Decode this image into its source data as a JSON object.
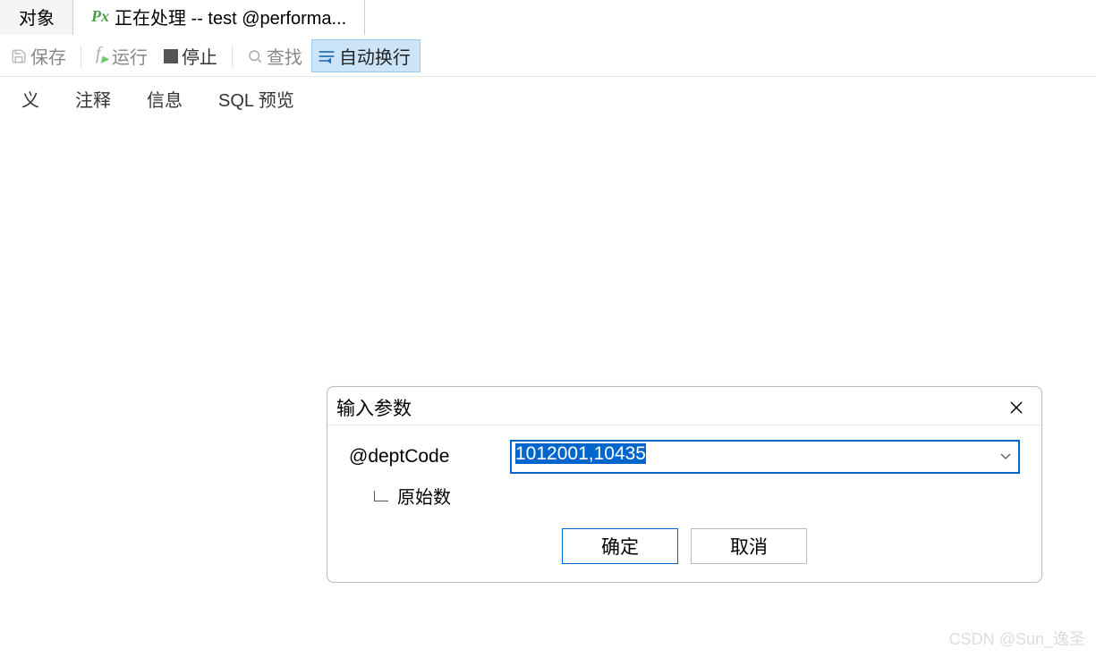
{
  "window_tabs": {
    "object": "对象",
    "processing": "正在处理 -- test @performa..."
  },
  "toolbar": {
    "save": "保存",
    "run": "运行",
    "stop": "停止",
    "find": "查找",
    "autowrap": "自动换行"
  },
  "subtabs": {
    "definition": "义",
    "comment": "注释",
    "info": "信息",
    "sql_preview": "SQL 预览"
  },
  "dialog": {
    "title": "输入参数",
    "param_label": "@deptCode",
    "param_value": "1012001,10435",
    "raw_label": "原始数",
    "ok": "确定",
    "cancel": "取消"
  },
  "watermark": "CSDN @Sun_逸圣"
}
